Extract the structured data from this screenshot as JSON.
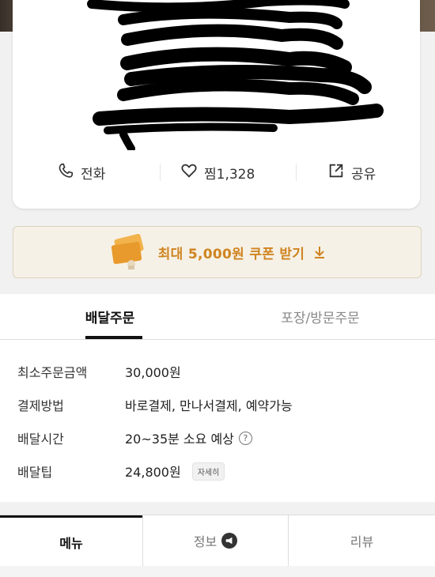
{
  "actions": {
    "call_label": "전화",
    "like_label": "찜1,328",
    "share_label": "공유"
  },
  "coupon": {
    "label": "최대 5,000원 쿠폰 받기"
  },
  "order_tabs": [
    {
      "label": "배달주문",
      "active": true
    },
    {
      "label": "포장/방문주문",
      "active": false
    }
  ],
  "details": [
    {
      "label": "최소주문금액",
      "value": "30,000원"
    },
    {
      "label": "결제방법",
      "value": "바로결제, 만나서결제, 예약가능"
    },
    {
      "label": "배달시간",
      "value": "20~35분 소요 예상"
    },
    {
      "label": "배달팁",
      "value": "24,800원",
      "button": "자세히"
    }
  ],
  "bottom_tabs": [
    {
      "label": "메뉴",
      "active": true
    },
    {
      "label": "정보",
      "active": false
    },
    {
      "label": "리뷰",
      "active": false
    }
  ],
  "colors": {
    "coupon_text": "#cf8420",
    "coupon_bg": "#f6f1e6"
  }
}
